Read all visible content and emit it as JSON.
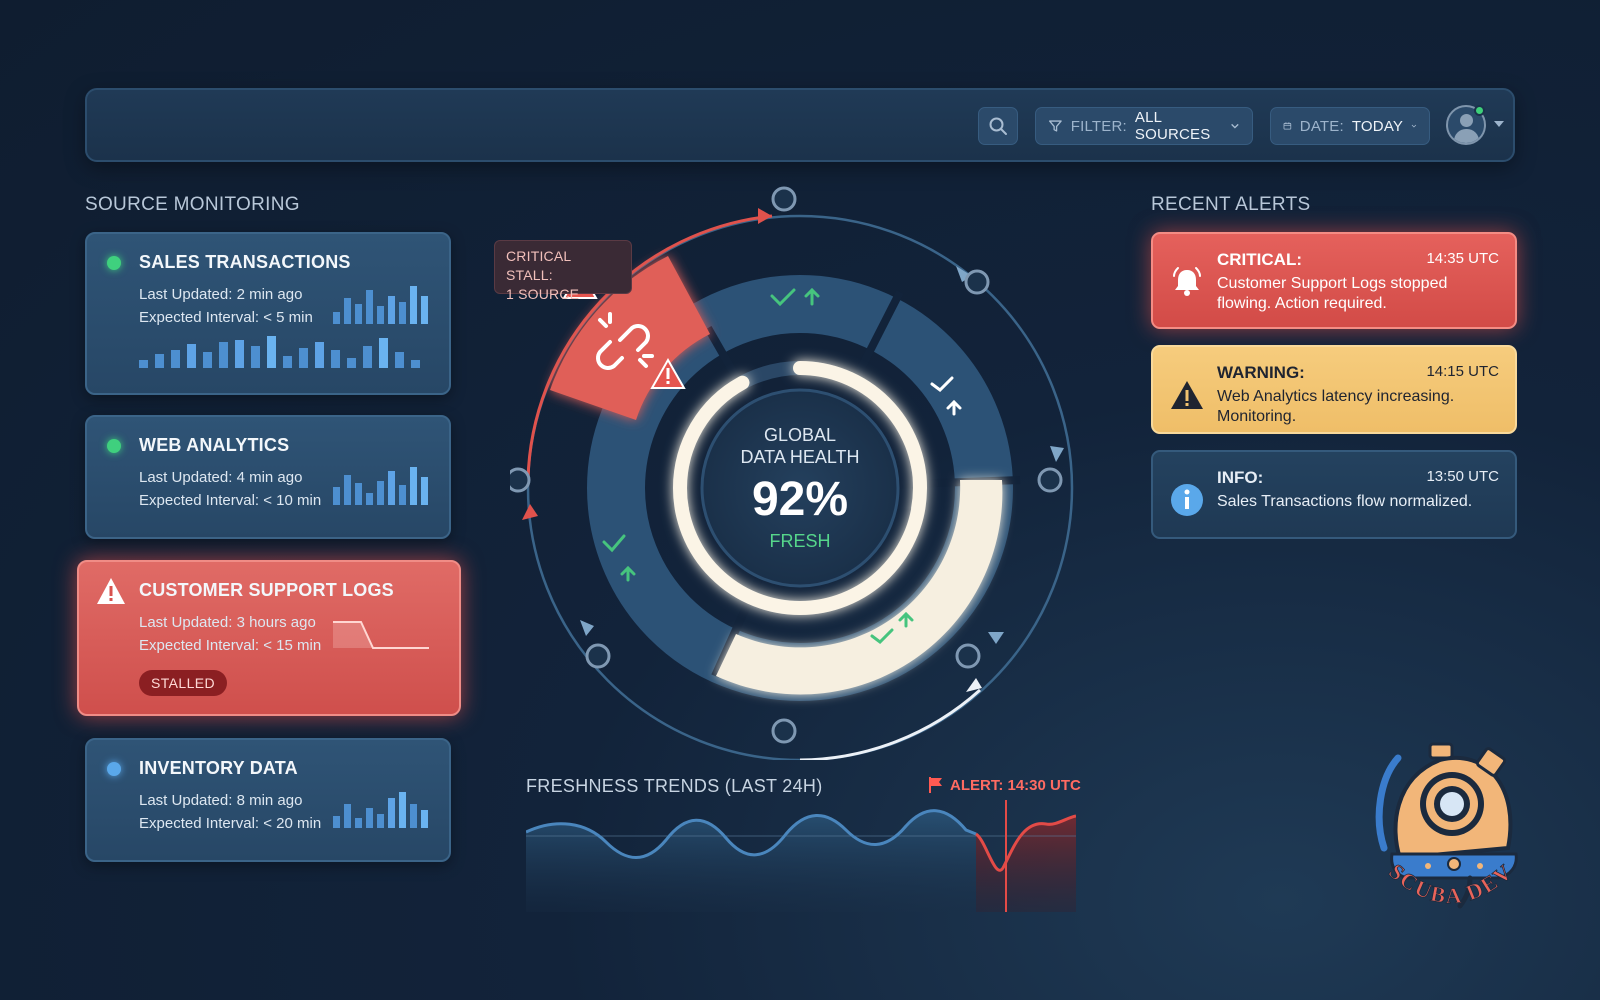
{
  "topbar": {
    "filter_key": "FILTER:",
    "filter_value": "ALL SOURCES",
    "date_key": "DATE:",
    "date_value": "TODAY"
  },
  "source_monitoring": {
    "title": "SOURCE MONITORING",
    "sources": [
      {
        "name": "SALES TRANSACTIONS",
        "last_updated": "Last Updated: 2 min ago",
        "expected_interval": "Expected Interval: < 5 min",
        "status_color": "#3fd07e"
      },
      {
        "name": "WEB ANALYTICS",
        "last_updated": "Last Updated: 4 min ago",
        "expected_interval": "Expected Interval: < 10 min",
        "status_color": "#3fd07e"
      },
      {
        "name": "CUSTOMER SUPPORT LOGS",
        "last_updated": "Last Updated: 3 hours ago",
        "expected_interval": "Expected Interval: < 15 min",
        "badge": "STALLED"
      },
      {
        "name": "INVENTORY DATA",
        "last_updated": "Last Updated: 8 min ago",
        "expected_interval": "Expected Interval: < 20 min",
        "status_color": "#5aa8ea"
      }
    ]
  },
  "gauge": {
    "callout": [
      "CRITICAL STALL:",
      "1 SOURCE"
    ],
    "title_line1": "GLOBAL",
    "title_line2": "DATA HEALTH",
    "value": "92%",
    "status": "FRESH",
    "health_fraction": 0.92
  },
  "trends": {
    "title": "FRESHNESS TRENDS (LAST 24H)",
    "alert_label": "ALERT: 14:30 UTC"
  },
  "recent_alerts": {
    "title": "RECENT ALERTS",
    "items": [
      {
        "level": "CRITICAL:",
        "time": "14:35 UTC",
        "message": "Customer Support Logs stopped flowing. Action required."
      },
      {
        "level": "WARNING:",
        "time": "14:15 UTC",
        "message": "Web Analytics latency increasing. Monitoring."
      },
      {
        "level": "INFO:",
        "time": "13:50 UTC",
        "message": "Sales Transactions flow normalized."
      }
    ]
  },
  "logo_text": "SCUBA DEV",
  "colors": {
    "critical": "#d8524e",
    "warning": "#f2c36f",
    "fresh": "#3fd07e",
    "panel": "#2a4a6a"
  }
}
